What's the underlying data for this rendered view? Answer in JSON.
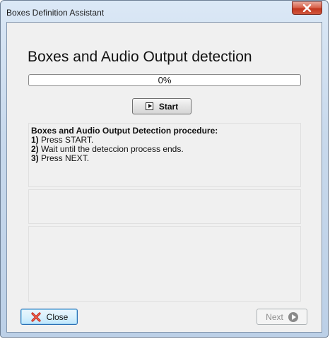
{
  "window": {
    "title": "Boxes Definition Assistant",
    "title_close_icon": "close-x-icon"
  },
  "main": {
    "heading": "Boxes and Audio Output detection",
    "progress": {
      "value": 0,
      "label": "0%"
    },
    "start_button": {
      "label": "Start",
      "icon": "play-icon"
    },
    "procedure": {
      "title": "Boxes and Audio Output Detection procedure:",
      "steps": [
        {
          "num": "1)",
          "text": " Press START."
        },
        {
          "num": "2)",
          "text": " Wait until the deteccion process ends."
        },
        {
          "num": "3)",
          "text": " Press NEXT."
        }
      ]
    }
  },
  "footer": {
    "close_button": {
      "label": "Close",
      "icon": "red-x-icon"
    },
    "next_button": {
      "label": "Next",
      "icon": "arrow-right-circle-icon"
    }
  },
  "colors": {
    "titlebar_close": "#c2361e",
    "progress_fill": "#06b025",
    "client_bg": "#f0f0f0"
  }
}
